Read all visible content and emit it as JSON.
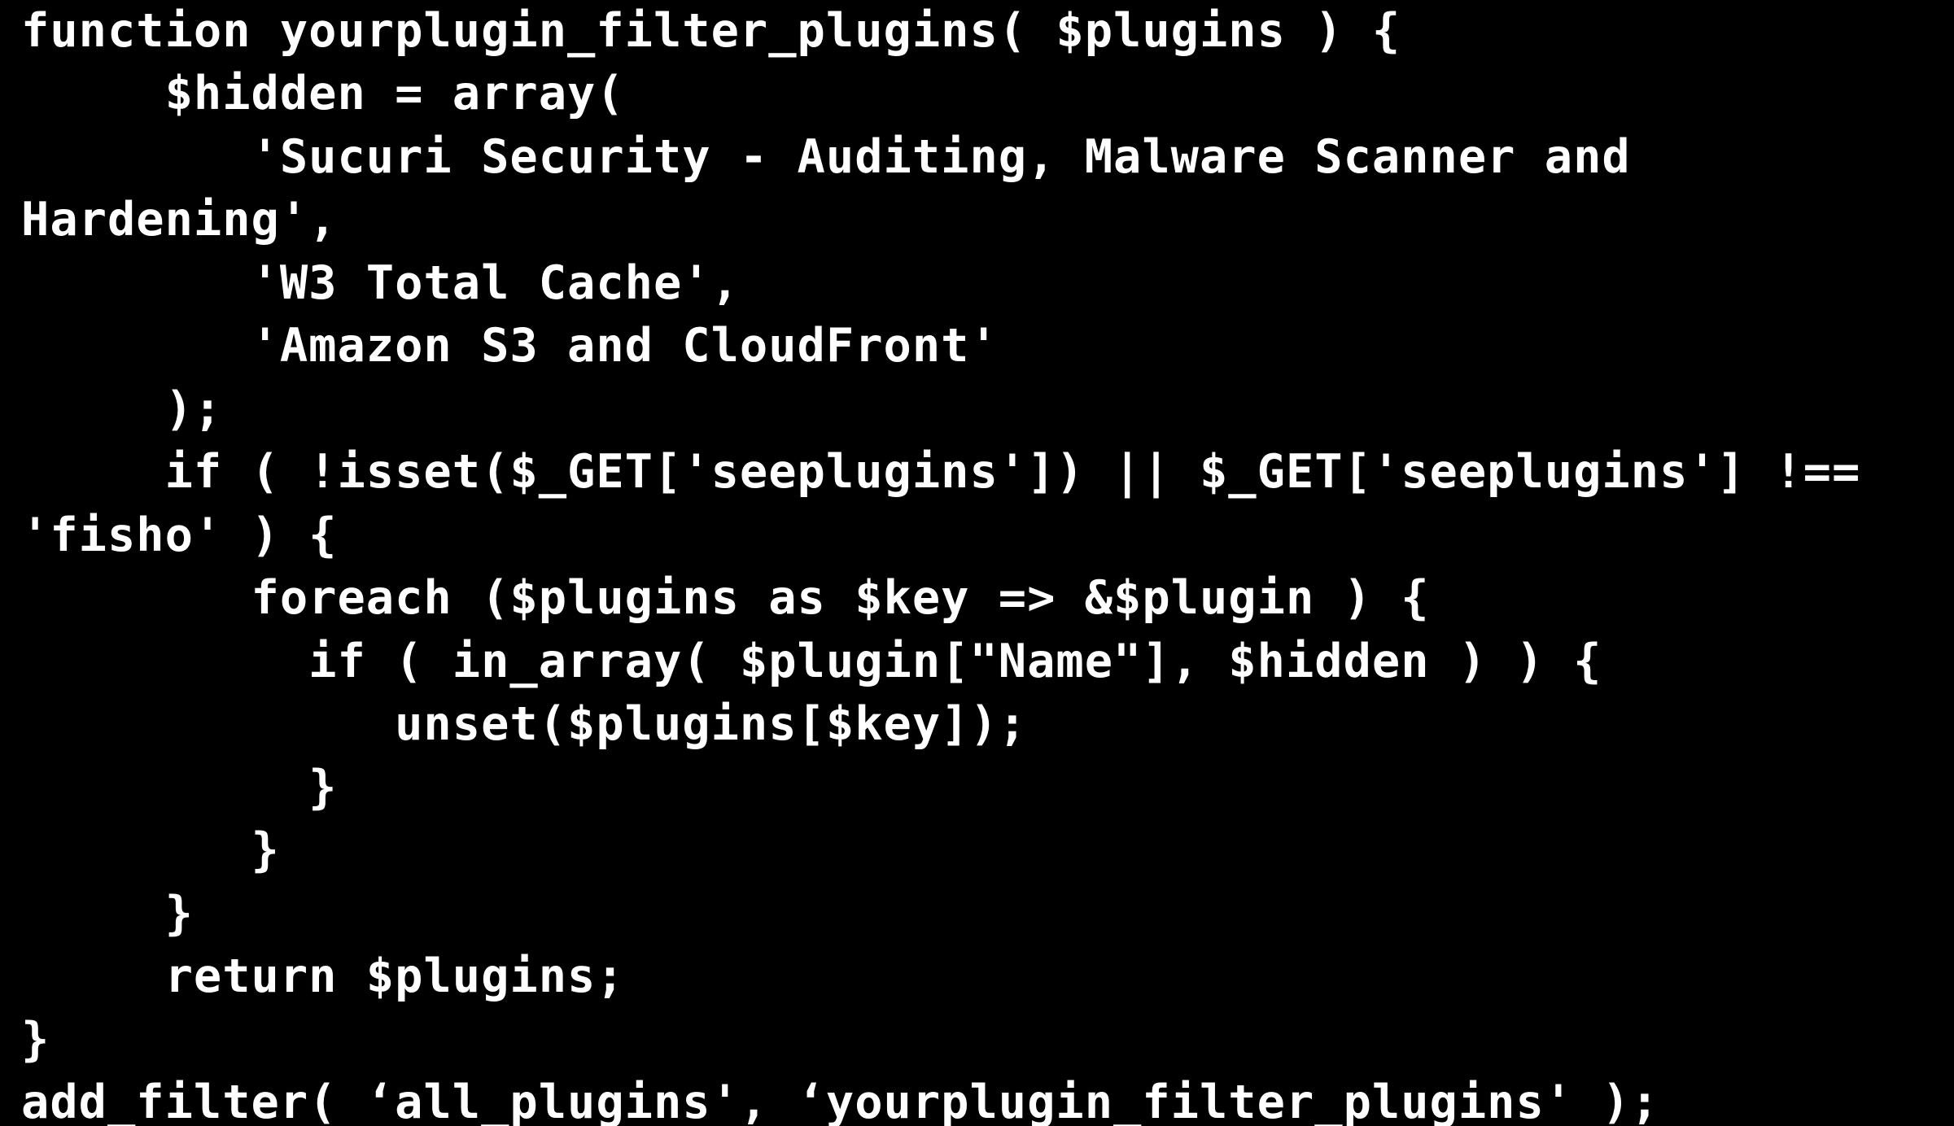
{
  "code": {
    "lines": [
      "function yourplugin_filter_plugins( $plugins ) {",
      "     $hidden = array(",
      "        'Sucuri Security - Auditing, Malware Scanner and",
      "Hardening',",
      "        'W3 Total Cache',",
      "        'Amazon S3 and CloudFront'",
      "     );",
      "     if ( !isset($_GET['seeplugins']) || $_GET['seeplugins'] !==",
      "'fisho' ) {",
      "        foreach ($plugins as $key => &$plugin ) {",
      "          if ( in_array( $plugin[\"Name\"], $hidden ) ) {",
      "             unset($plugins[$key]);",
      "          }",
      "        }",
      "     }",
      "     return $plugins;",
      "}",
      "add_filter( ‘all_plugins', ‘yourplugin_filter_plugins' );"
    ]
  }
}
